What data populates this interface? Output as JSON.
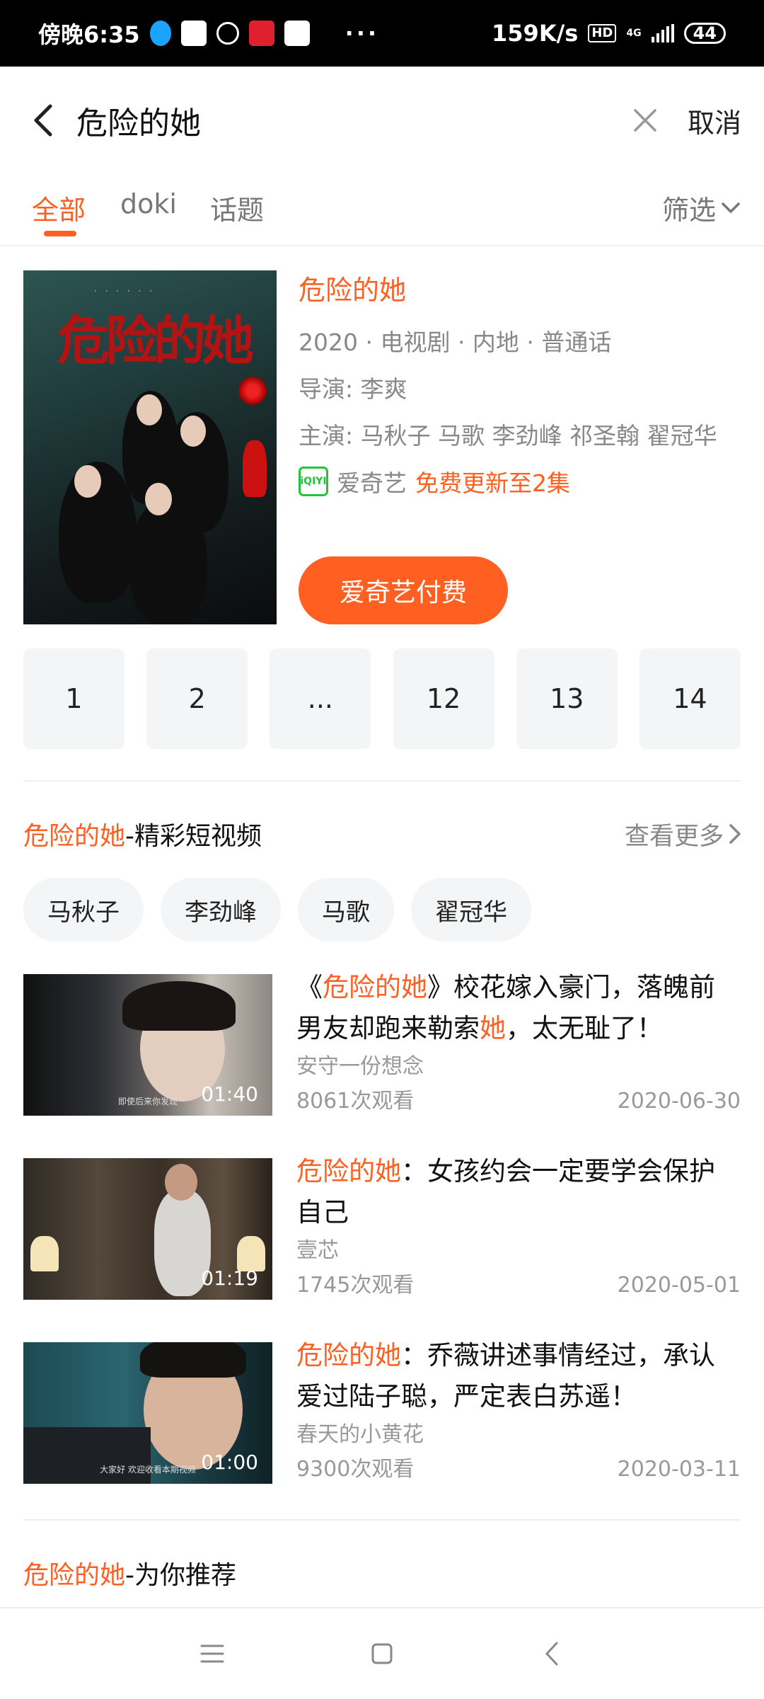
{
  "status_bar": {
    "time": "傍晚6:35",
    "dots": "···",
    "speed": "159K/s",
    "hd": "HD",
    "network": "4G",
    "battery": "44"
  },
  "search": {
    "query": "危险的她",
    "cancel_label": "取消"
  },
  "tabs": [
    {
      "label": "全部",
      "active": true
    },
    {
      "label": "doki",
      "active": false
    },
    {
      "label": "话题",
      "active": false
    }
  ],
  "filter_label": "筛选",
  "show": {
    "poster_title": "危险的她",
    "title": "危险的她",
    "meta": "2020 · 电视剧 · 内地 · 普通话",
    "director": "导演: 李爽",
    "cast": "主演: 马秋子 马歌 李劲峰 祁圣翰 翟冠华",
    "platform_logo": "iQIYI",
    "platform": "爱奇艺",
    "update": "免费更新至2集",
    "pay_button": "爱奇艺付费"
  },
  "episodes": [
    "1",
    "2",
    "...",
    "12",
    "13",
    "14"
  ],
  "short_videos": {
    "title_highlight": "危险的她",
    "title_rest": "-精彩短视频",
    "see_more": "查看更多",
    "chips": [
      "马秋子",
      "李劲峰",
      "马歌",
      "翟冠华"
    ],
    "items": [
      {
        "title_pre": "《",
        "title_hl": "危险的她",
        "title_mid": "》校花嫁入豪门，落魄前男友却跑来勒索",
        "title_hl2": "她",
        "title_post": "，太无耻了！",
        "author": "安守一份想念",
        "views": "8061次观看",
        "date": "2020-06-30",
        "duration": "01:40",
        "caption": "即使后来你发现"
      },
      {
        "title_pre": "",
        "title_hl": "危险的她",
        "title_mid": "：女孩约会一定要学会保护自己",
        "title_hl2": "",
        "title_post": "",
        "author": "壹芯",
        "views": "1745次观看",
        "date": "2020-05-01",
        "duration": "01:19",
        "caption": ""
      },
      {
        "title_pre": "",
        "title_hl": "危险的她",
        "title_mid": "：乔薇讲述事情经过，承认爱过陆子聪，严定表白苏遥！",
        "title_hl2": "",
        "title_post": "",
        "author": "春天的小黄花",
        "views": "9300次观看",
        "date": "2020-03-11",
        "duration": "01:00",
        "caption": "大家好 欢迎收看本期视频"
      }
    ]
  },
  "recommend": {
    "title_highlight": "危险的她",
    "title_rest": "-为你推荐"
  },
  "colors": {
    "accent": "#ff6022",
    "iqiyi_green": "#23c33a"
  }
}
